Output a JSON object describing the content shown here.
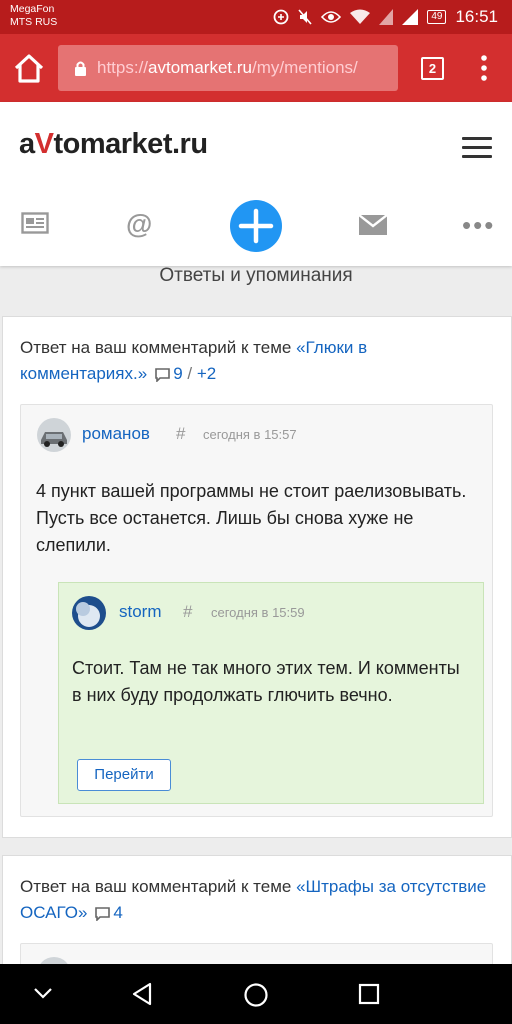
{
  "status": {
    "carrier_line1": "MegaFon",
    "carrier_line2": "MTS RUS",
    "battery": "49",
    "time": "16:51"
  },
  "browser": {
    "url_scheme": "https://",
    "url_host": "avtomarket.ru",
    "url_path": "/my/mentions/",
    "tab_count": "2"
  },
  "site": {
    "logo_a": "a",
    "logo_v": "V",
    "logo_rest": "tomarket.ru",
    "nav_at": "@",
    "nav_more": "•••"
  },
  "page": {
    "title": "Ответы и упоминания"
  },
  "cards": [
    {
      "prefix": "Ответ на ваш комментарий к теме ",
      "topic": "«Глюки в комментариях.»",
      "count": "9",
      "sep": " / ",
      "plus": "+2",
      "comment": {
        "author": "романов",
        "hash": "#",
        "time": "сегодня в 15:57",
        "text": "4 пункт вашей программы не стоит раелизовывать. Пусть все останется. Лишь бы снова хуже не слепили."
      },
      "reply": {
        "author": "storm",
        "hash": "#",
        "time": "сегодня в 15:59",
        "text": "Стоит. Там не так много этих тем. И комменты в них буду продолжать глючить вечно.",
        "button": "Перейти"
      }
    },
    {
      "prefix": "Ответ на ваш комментарий к теме ",
      "topic": "«Штрафы за отсутствие ОСАГО»",
      "count": "4"
    }
  ],
  "colors": {
    "statusbar": "#b71c1c",
    "toolbar": "#d32f2f",
    "accent_blue": "#2196f3",
    "link": "#1565c0",
    "reply_bg": "#e6f5dc"
  },
  "icons": [
    "data-saver-icon",
    "eye-icon",
    "wifi-icon",
    "sim-icon",
    "signal-icon",
    "home-icon",
    "lock-icon",
    "tabs-icon",
    "overflow-menu-icon",
    "hamburger-icon",
    "feed-icon",
    "at-icon",
    "plus-icon",
    "mail-icon",
    "more-icon",
    "comment-icon",
    "back-icon",
    "home-circle-icon",
    "recents-icon",
    "collapse-icon"
  ]
}
